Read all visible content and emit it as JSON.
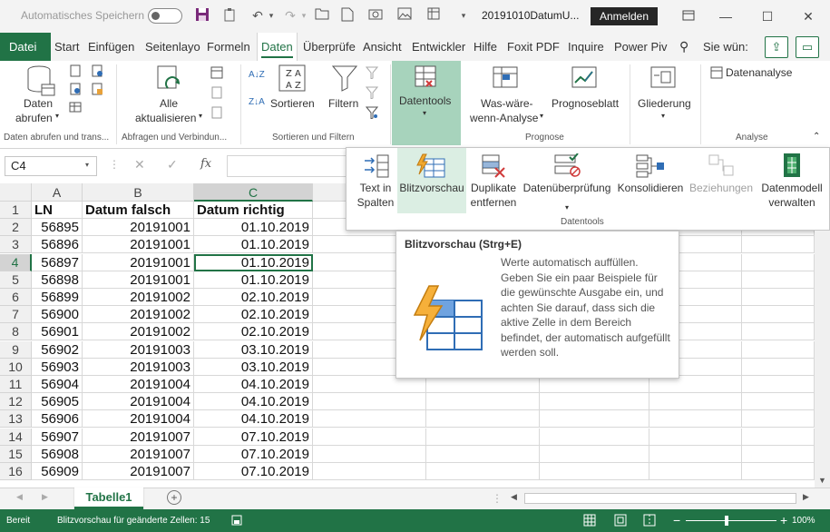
{
  "titlebar": {
    "autosave_label": "Automatisches Speichern",
    "doc_title": "20191010DatumU...",
    "signin_label": "Anmelden"
  },
  "tabs": {
    "file": "Datei",
    "items": [
      "Start",
      "Einfügen",
      "Seitenlayo",
      "Formeln",
      "Daten",
      "Überprüfe",
      "Ansicht",
      "Entwickler",
      "Hilfe",
      "Foxit PDF",
      "Inquire",
      "Power Piv"
    ],
    "active": "Daten",
    "search_label": "Sie wün:"
  },
  "ribbon": {
    "daten_abrufen": "Daten",
    "daten_abrufen2": "abrufen",
    "group1": "Daten abrufen und trans...",
    "alle_akt1": "Alle",
    "alle_akt2": "aktualisieren",
    "group2": "Abfragen und Verbindun...",
    "sortieren": "Sortieren",
    "filtern": "Filtern",
    "group3": "Sortieren und Filtern",
    "datentools": "Datentools",
    "waswaere1": "Was-wäre-",
    "waswaere2": "wenn-Analyse",
    "prognoseblatt": "Prognoseblatt",
    "group4": "Prognose",
    "gliederung": "Gliederung",
    "datenanalyse": "Datenanalyse",
    "group5": "Analyse"
  },
  "formula_bar": {
    "namebox": "C4",
    "fx": "fx"
  },
  "grid": {
    "columns": [
      "A",
      "B",
      "C"
    ],
    "header_row": [
      "LN",
      "Datum falsch",
      "Datum richtig"
    ],
    "rows": [
      [
        "56895",
        "20191001",
        "01.10.2019"
      ],
      [
        "56896",
        "20191001",
        "01.10.2019"
      ],
      [
        "56897",
        "20191001",
        "01.10.2019"
      ],
      [
        "56898",
        "20191001",
        "01.10.2019"
      ],
      [
        "56899",
        "20191002",
        "02.10.2019"
      ],
      [
        "56900",
        "20191002",
        "02.10.2019"
      ],
      [
        "56901",
        "20191002",
        "02.10.2019"
      ],
      [
        "56902",
        "20191003",
        "03.10.2019"
      ],
      [
        "56903",
        "20191003",
        "03.10.2019"
      ],
      [
        "56904",
        "20191004",
        "04.10.2019"
      ],
      [
        "56905",
        "20191004",
        "04.10.2019"
      ],
      [
        "56906",
        "20191004",
        "04.10.2019"
      ],
      [
        "56907",
        "20191007",
        "07.10.2019"
      ],
      [
        "56908",
        "20191007",
        "07.10.2019"
      ],
      [
        "56909",
        "20191007",
        "07.10.2019"
      ]
    ],
    "row_numbers": [
      "1",
      "2",
      "3",
      "4",
      "5",
      "6",
      "7",
      "8",
      "9",
      "10",
      "11",
      "12",
      "13",
      "14",
      "15",
      "16"
    ]
  },
  "datentools_panel": {
    "items": [
      {
        "line1": "Text in",
        "line2": "Spalten"
      },
      {
        "line1": "Blitzvorschau",
        "line2": ""
      },
      {
        "line1": "Duplikate",
        "line2": "entfernen"
      },
      {
        "line1": "Datenüberprüfung",
        "line2": ""
      },
      {
        "line1": "Konsolidieren",
        "line2": ""
      },
      {
        "line1": "Beziehungen",
        "line2": ""
      },
      {
        "line1": "Datenmodell",
        "line2": "verwalten"
      }
    ],
    "footer": "Datentools"
  },
  "tooltip": {
    "title": "Blitzvorschau (Strg+E)",
    "body": "Werte automatisch auffüllen. Geben Sie ein paar Beispiele für die gewünschte Ausgabe ein, und achten Sie darauf, dass sich die aktive Zelle in dem Bereich befindet, der automatisch aufgefüllt werden soll."
  },
  "sheets": {
    "active": "Tabelle1"
  },
  "statusbar": {
    "mode": "Bereit",
    "message": "Blitzvorschau für geänderte Zellen: 15",
    "zoom": "100%"
  },
  "colors": {
    "accent": "#217346",
    "highlight": "#a7d3bc"
  }
}
